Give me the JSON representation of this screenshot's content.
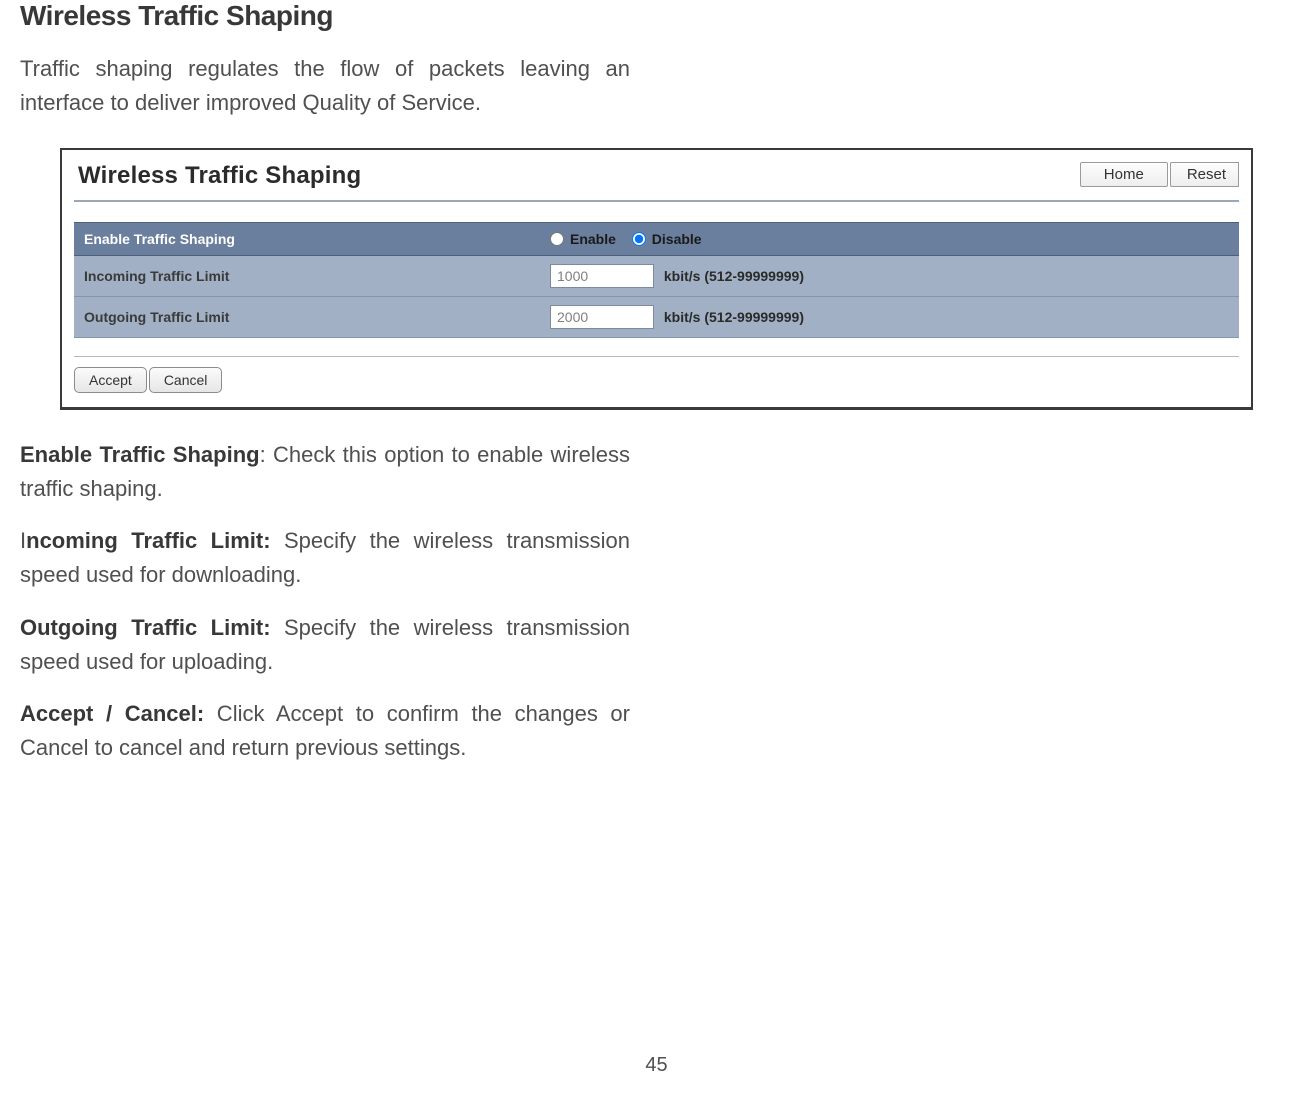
{
  "page": {
    "heading": "Wireless Traffic Shaping",
    "intro": "Traffic shaping regulates the flow of packets leaving an interface to deliver improved Quality of Service.",
    "page_number": "45"
  },
  "panel": {
    "title": "Wireless Traffic Shaping",
    "buttons": {
      "home": "Home",
      "reset": "Reset",
      "accept": "Accept",
      "cancel": "Cancel"
    },
    "rows": {
      "enable": {
        "label": "Enable Traffic Shaping",
        "option_enable": "Enable",
        "option_disable": "Disable",
        "selection": "disable"
      },
      "incoming": {
        "label": "Incoming Traffic Limit",
        "value": "1000",
        "unit": "kbit/s (512-99999999)"
      },
      "outgoing": {
        "label": "Outgoing Traffic Limit",
        "value": "2000",
        "unit": "kbit/s (512-99999999)"
      }
    }
  },
  "definitions": {
    "enable_shaping": {
      "term": "Enable Traffic Shaping",
      "text": ": Check this option to enable wireless traffic shaping."
    },
    "incoming": {
      "prefix": "I",
      "term": "ncoming Traffic Limit:",
      "text": " Specify the wireless transmission speed used for downloading."
    },
    "outgoing": {
      "term": "Outgoing Traffic Limit:",
      "text": " Specify the wireless transmission speed used for uploading."
    },
    "accept_cancel": {
      "term": "Accept / Cancel:",
      "text": " Click Accept to confirm the changes or Cancel to cancel and return previous settings."
    }
  }
}
